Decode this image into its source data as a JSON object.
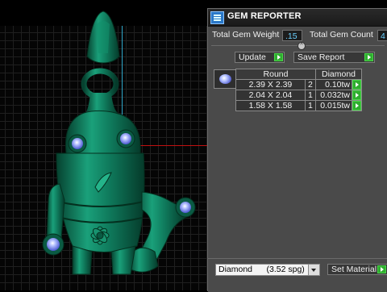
{
  "window": {
    "title": "GEM REPORTER"
  },
  "summary": {
    "total_weight_label": "Total Gem Weight",
    "total_weight_value": ".15",
    "total_count_label": "Total Gem Count",
    "total_count_value": "4"
  },
  "actions": {
    "update_label": "Update",
    "save_report_label": "Save Report"
  },
  "gem_table": {
    "headers": [
      "Round",
      "Diamond"
    ],
    "rows": [
      {
        "size": "2.39 X 2.39",
        "count": "2",
        "weight": "0.10tw"
      },
      {
        "size": "2.04 X 2.04",
        "count": "1",
        "weight": "0.032tw"
      },
      {
        "size": "1.58 X 1.58",
        "count": "1",
        "weight": "0.015tw"
      }
    ]
  },
  "material": {
    "selected": "Diamond      (3.52 spg)",
    "set_label": "Set Material"
  },
  "colors": {
    "accent_green": "#2fae2f",
    "value_blue": "#6ad0ff",
    "model_green": "#0f7a5c",
    "gem_blue": "#8ea0ff"
  },
  "icons": [
    "gem-reporter-app-icon",
    "collapse-icon",
    "play-arrow-icon",
    "dropdown-arrow-icon",
    "round-gem-icon"
  ]
}
